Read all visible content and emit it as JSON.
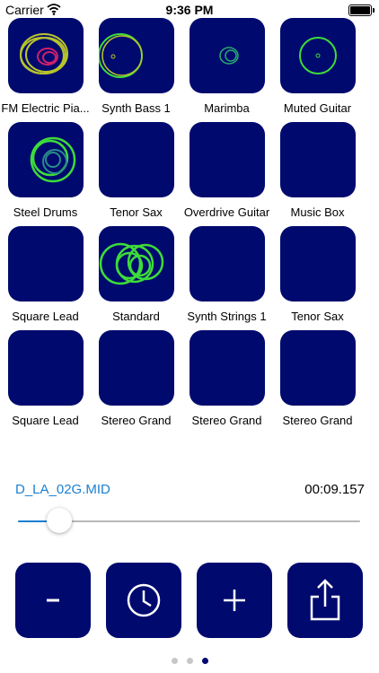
{
  "status_bar": {
    "carrier": "Carrier",
    "time": "9:36 PM"
  },
  "instruments": [
    {
      "label": "FM Electric Pia...",
      "visual": "rings-yellow-red"
    },
    {
      "label": "Synth Bass 1",
      "visual": "rings-green-yellow"
    },
    {
      "label": "Marimba",
      "visual": "rings-small-green"
    },
    {
      "label": "Muted Guitar",
      "visual": "ring-green"
    },
    {
      "label": "Steel Drums",
      "visual": "rings-green"
    },
    {
      "label": "Tenor Sax",
      "visual": "none"
    },
    {
      "label": "Overdrive Guitar",
      "visual": "none"
    },
    {
      "label": "Music Box",
      "visual": "none"
    },
    {
      "label": "Square Lead",
      "visual": "none"
    },
    {
      "label": "Standard",
      "visual": "rings-green-cluster"
    },
    {
      "label": "Synth Strings 1",
      "visual": "none"
    },
    {
      "label": "Tenor Sax",
      "visual": "none"
    },
    {
      "label": "Square Lead",
      "visual": "none"
    },
    {
      "label": "Stereo Grand",
      "visual": "none"
    },
    {
      "label": "Stereo Grand",
      "visual": "none"
    },
    {
      "label": "Stereo Grand",
      "visual": "none"
    }
  ],
  "player": {
    "file_name": "D_LA_02G.MID",
    "elapsed": "00:09.157",
    "progress": 0.12
  },
  "controls": [
    {
      "name": "minus",
      "icon": "minus-icon"
    },
    {
      "name": "history",
      "icon": "clock-icon"
    },
    {
      "name": "add",
      "icon": "plus-icon"
    },
    {
      "name": "share",
      "icon": "share-icon"
    }
  ],
  "pages": {
    "count": 3,
    "current": 3
  },
  "colors": {
    "pad": "#000a6e",
    "accent": "#1b7fd1",
    "ring_green": "#3ddc3a",
    "ring_yellow": "#b7c42a",
    "ring_red": "#d0206a"
  }
}
